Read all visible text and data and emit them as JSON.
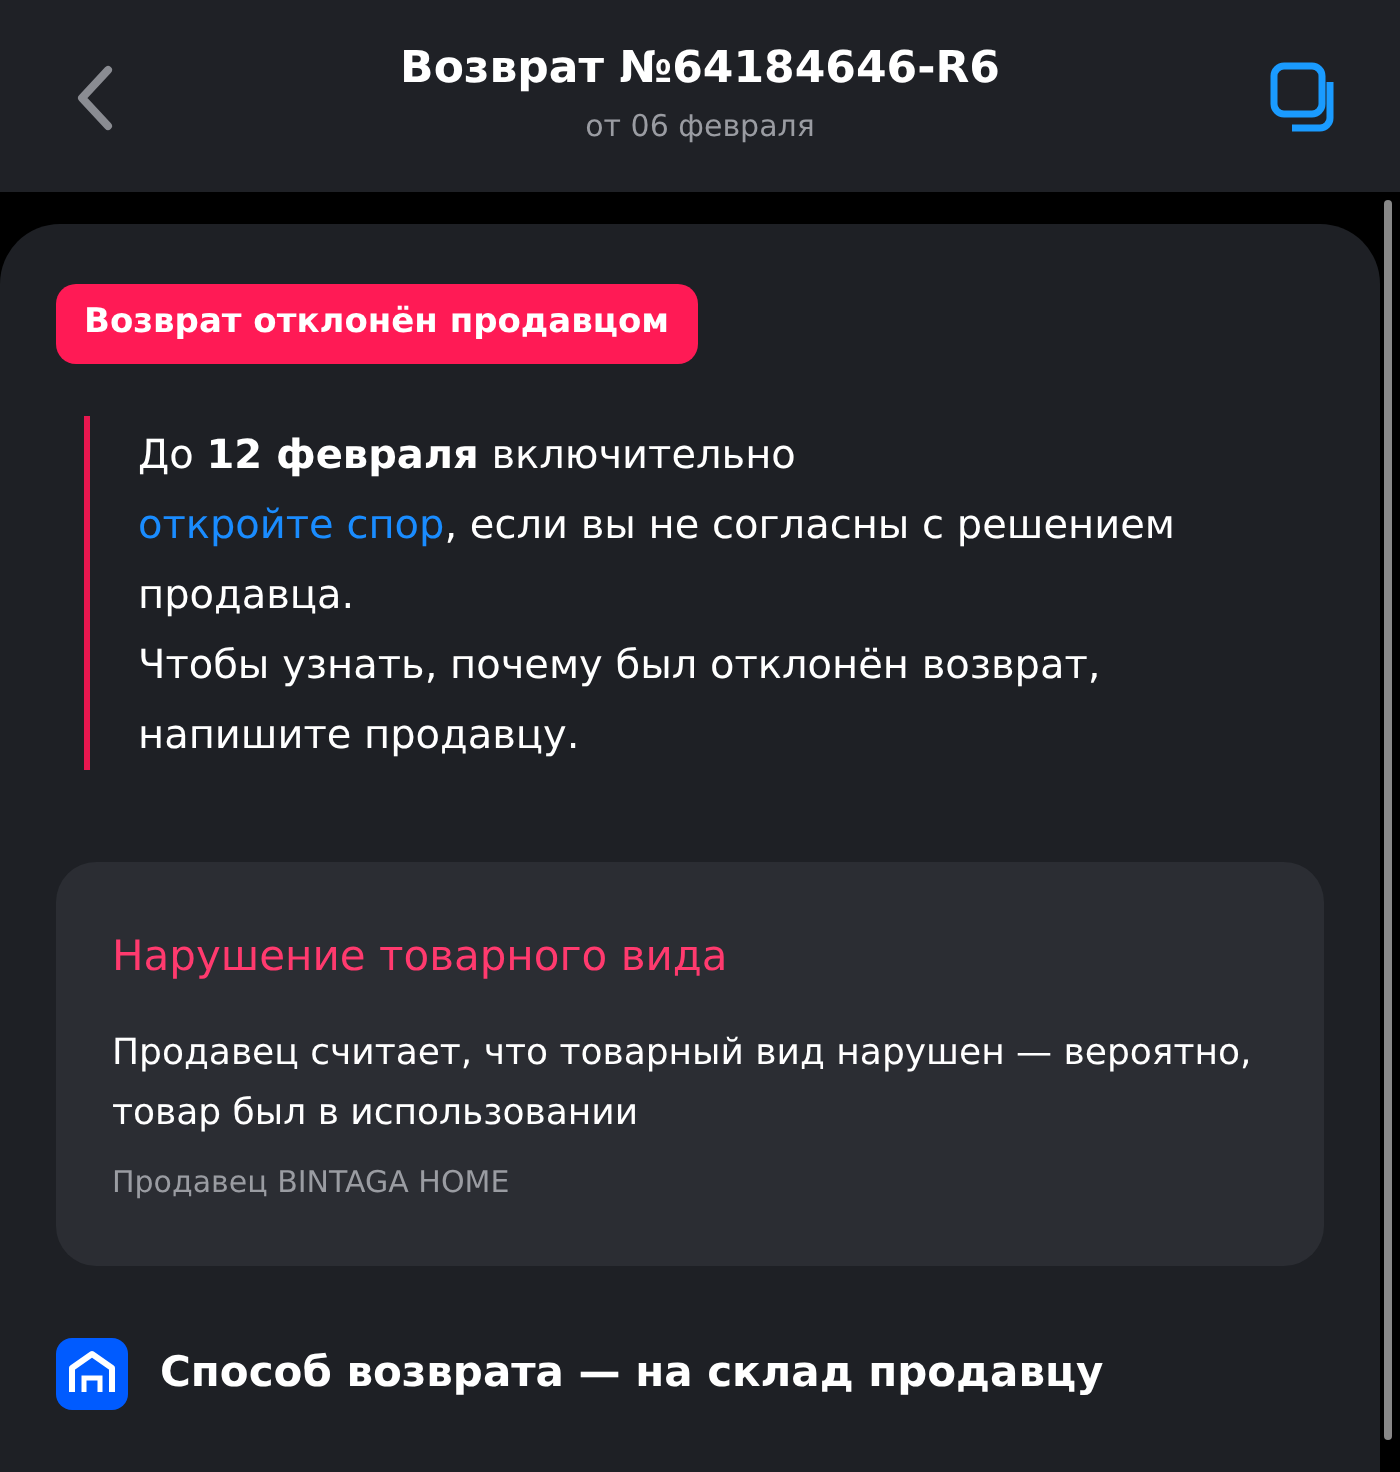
{
  "header": {
    "title": "Возврат №64184646-R6",
    "subtitle": "от 06 февраля"
  },
  "status_badge": "Возврат отклонён продавцом",
  "notice": {
    "lead": "До **12 февраля** включительно",
    "link": "откройте спор",
    "rest": ", если вы не согласны с решением продавца.",
    "note": "Чтобы узнать, почему был отклонён возврат, напишите продавцу."
  },
  "reason": {
    "title": "Нарушение товарного вида",
    "text": "Продавец считает, что товарный вид нарушен — вероятно, товар был в использовании",
    "seller": "Продавец BINTAGA HOME"
  },
  "return_method": "Способ возврата — на склад продавцу"
}
